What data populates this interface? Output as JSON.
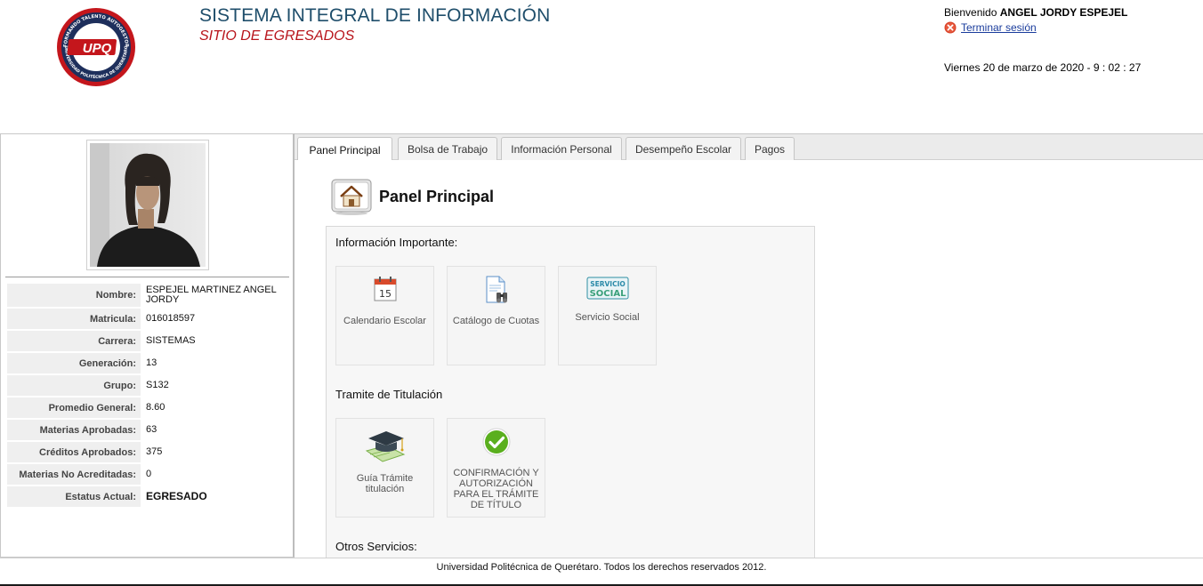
{
  "header": {
    "title": "SISTEMA INTEGRAL DE INFORMACIÓN",
    "subtitle": "SITIO DE EGRESADOS",
    "welcome_prefix": "Bienvenido",
    "user_name": "ANGEL JORDY ESPEJEL",
    "logout_label": "Terminar sesión",
    "datetime": "Viernes 20 de marzo de 2020 - 9 : 02 : 27",
    "logo": {
      "ring_text_top": "FORMANDO TALENTO AUTOGESTOR",
      "ring_text_bottom": "UNIVERSIDAD POLITÉCNICA DE QUERÉTARO",
      "center_text": "UPQ"
    }
  },
  "profile": {
    "rows": [
      {
        "label": "Nombre:",
        "value": "ESPEJEL MARTINEZ ANGEL JORDY"
      },
      {
        "label": "Matricula:",
        "value": "016018597"
      },
      {
        "label": "Carrera:",
        "value": "SISTEMAS"
      },
      {
        "label": "Generación:",
        "value": "13"
      },
      {
        "label": "Grupo:",
        "value": "S132"
      },
      {
        "label": "Promedio General:",
        "value": "8.60"
      },
      {
        "label": "Materias Aprobadas:",
        "value": "63"
      },
      {
        "label": "Créditos Aprobados:",
        "value": "375"
      },
      {
        "label": "Materias No Acreditadas:",
        "value": "0"
      },
      {
        "label": "Estatus Actual:",
        "value": "EGRESADO"
      }
    ]
  },
  "tabs": [
    {
      "label": "Panel Principal",
      "active": true
    },
    {
      "label": "Bolsa de Trabajo",
      "active": false
    },
    {
      "label": "Información Personal",
      "active": false
    },
    {
      "label": "Desempeño Escolar",
      "active": false
    },
    {
      "label": "Pagos",
      "active": false
    }
  ],
  "panel": {
    "title": "Panel Principal",
    "sections": [
      {
        "title": "Información Importante:",
        "tiles": [
          {
            "label": "Calendario Escolar",
            "icon": "calendar-icon",
            "calendar_day": "15"
          },
          {
            "label": "Catálogo de Cuotas",
            "icon": "document-binoculars-icon"
          },
          {
            "label": "Servicio Social",
            "icon": "servicio-social-icon",
            "icon_text_1": "SERVICIO",
            "icon_text_2": "SOCIAL"
          }
        ]
      },
      {
        "title": "Tramite de Titulación",
        "tiles": [
          {
            "label": "Guía Trámite titulación",
            "icon": "graduation-cap-icon"
          },
          {
            "label": "CONFIRMACIÓN Y AUTORIZACIÓN PARA EL TRÁMITE DE TÍTULO",
            "icon": "checkmark-icon"
          }
        ]
      },
      {
        "title": "Otros Servicios:",
        "tiles": []
      }
    ]
  },
  "footer": {
    "text": "Universidad Politécnica de Querétaro. Todos los derechos reservados 2012."
  },
  "colors": {
    "title_blue": "#1f4e6b",
    "subtitle_red": "#b8141b",
    "logo_navy": "#1e2f5c",
    "logo_red": "#c4161c",
    "check_green": "#5aaf1e"
  }
}
